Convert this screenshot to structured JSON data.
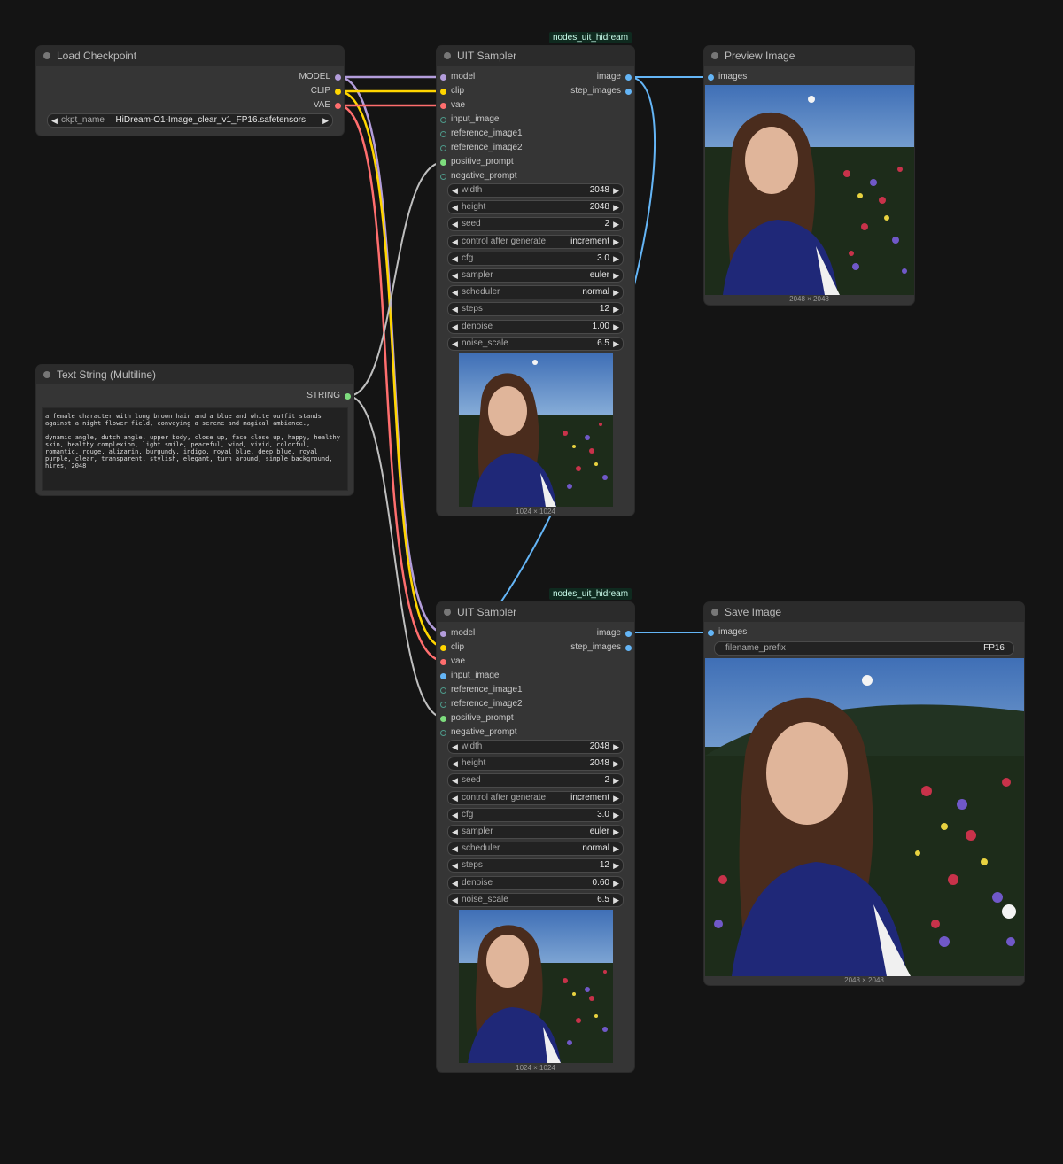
{
  "colors": {
    "model": "#b39ddb",
    "clip": "#ffd500",
    "vae": "#ff6e6e",
    "image": "#64b5f6",
    "string": "#7ddc7d",
    "conditioning": "#bfbfbf"
  },
  "load_checkpoint": {
    "title": "Load Checkpoint",
    "outputs": [
      "MODEL",
      "CLIP",
      "VAE"
    ],
    "ckpt_label": "ckpt_name",
    "ckpt_value": "HiDream-O1-Image_clear_v1_FP16.safetensors"
  },
  "text_string": {
    "title": "Text String (Multiline)",
    "output": "STRING",
    "text": "a female character with long brown hair and a blue and white outfit stands against a night flower field, conveying a serene and magical ambiance.,\n\ndynamic angle, dutch angle, upper body, close up, face close up, happy, healthy skin, healthy complexion, light smile, peaceful, wind, vivid, colorful, romantic, rouge, alizarin, burgundy, indigo, royal blue, deep blue, royal purple, clear, transparent, stylish, elegant, turn around, simple background, hires, 2048"
  },
  "sampler1": {
    "badge": "nodes_uit_hidream",
    "title": "UIT Sampler",
    "inputs": [
      "model",
      "clip",
      "vae",
      "input_image",
      "reference_image1",
      "reference_image2",
      "positive_prompt",
      "negative_prompt"
    ],
    "outputs": [
      "image",
      "step_images"
    ],
    "widgets": [
      {
        "name": "width",
        "value": "2048"
      },
      {
        "name": "height",
        "value": "2048"
      },
      {
        "name": "seed",
        "value": "2"
      },
      {
        "name": "control after generate",
        "value": "increment"
      },
      {
        "name": "cfg",
        "value": "3.0"
      },
      {
        "name": "sampler",
        "value": "euler"
      },
      {
        "name": "scheduler",
        "value": "normal"
      },
      {
        "name": "steps",
        "value": "12"
      },
      {
        "name": "denoise",
        "value": "1.00"
      },
      {
        "name": "noise_scale",
        "value": "6.5"
      }
    ],
    "caption": "1024 × 1024"
  },
  "sampler2": {
    "badge": "nodes_uit_hidream",
    "title": "UIT Sampler",
    "inputs": [
      "model",
      "clip",
      "vae",
      "input_image",
      "reference_image1",
      "reference_image2",
      "positive_prompt",
      "negative_prompt"
    ],
    "outputs": [
      "image",
      "step_images"
    ],
    "widgets": [
      {
        "name": "width",
        "value": "2048"
      },
      {
        "name": "height",
        "value": "2048"
      },
      {
        "name": "seed",
        "value": "2"
      },
      {
        "name": "control after generate",
        "value": "increment"
      },
      {
        "name": "cfg",
        "value": "3.0"
      },
      {
        "name": "sampler",
        "value": "euler"
      },
      {
        "name": "scheduler",
        "value": "normal"
      },
      {
        "name": "steps",
        "value": "12"
      },
      {
        "name": "denoise",
        "value": "0.60"
      },
      {
        "name": "noise_scale",
        "value": "6.5"
      }
    ],
    "caption": "1024 × 1024"
  },
  "preview_image": {
    "title": "Preview Image",
    "input": "images",
    "caption": "2048 × 2048"
  },
  "save_image": {
    "title": "Save Image",
    "input": "images",
    "prefix_label": "filename_prefix",
    "prefix_value": "FP16",
    "caption": "2048 × 2048"
  }
}
